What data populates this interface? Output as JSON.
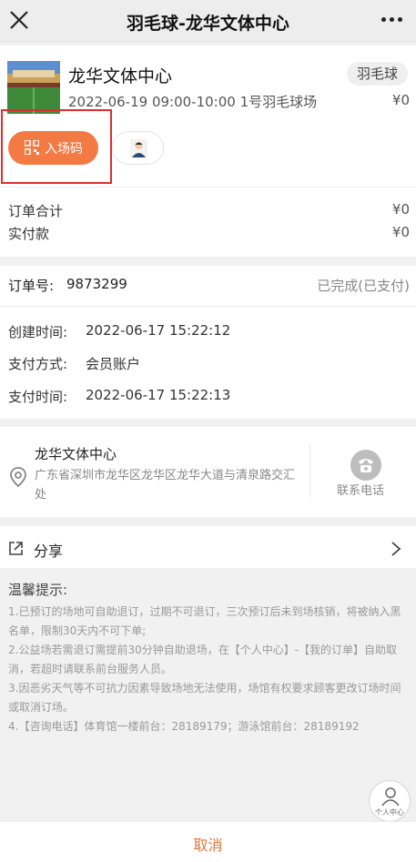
{
  "nav": {
    "title": "羽毛球-龙华文体中心"
  },
  "order_item": {
    "venue_name": "龙华文体中心",
    "sport_tag": "羽毛球",
    "slot": "2022-06-19 09:00-10:00 1号羽毛球场",
    "price": "¥0",
    "entry_button_label": "入场码"
  },
  "totals": {
    "order_total_label": "订单合计",
    "order_total_value": "¥0",
    "paid_label": "实付款",
    "paid_value": "¥0"
  },
  "order": {
    "number_label": "订单号:",
    "number_value": "9873299",
    "status": "已完成(已支付)",
    "created_label": "创建时间:",
    "created_value": "2022-06-17 15:22:12",
    "pay_method_label": "支付方式:",
    "pay_method_value": "会员账户",
    "paid_time_label": "支付时间:",
    "paid_time_value": "2022-06-17 15:22:13"
  },
  "location": {
    "name": "龙华文体中心",
    "address": "广东省深圳市龙华区龙华区龙华大道与清泉路交汇处",
    "contact_label": "联系电话"
  },
  "share": {
    "label": "分享"
  },
  "tips": {
    "title": "温馨提示:",
    "text": "1.已预订的场地可自助退订，过期不可退订，三次预订后未到场核销，将被纳入黑名单，限制30天内不可下单;\n2.公益场若需退订需提前30分钟自助退场，在【个人中心】-【我的订单】自助取消，若超时请联系前台服务人员。\n3.因恶劣天气等不可抗力因素导致场地无法使用，场馆有权要求顾客更改订场时间或取消订场。\n4.【咨询电话】体育馆一楼前台：28189179；游泳馆前台：28189192"
  },
  "personal_center": {
    "label": "个人中心"
  },
  "bottom": {
    "cancel_label": "取消"
  },
  "colors": {
    "accent": "#f47a44",
    "highlight_border": "#e02d2d",
    "cancel_text": "#e0773e"
  }
}
